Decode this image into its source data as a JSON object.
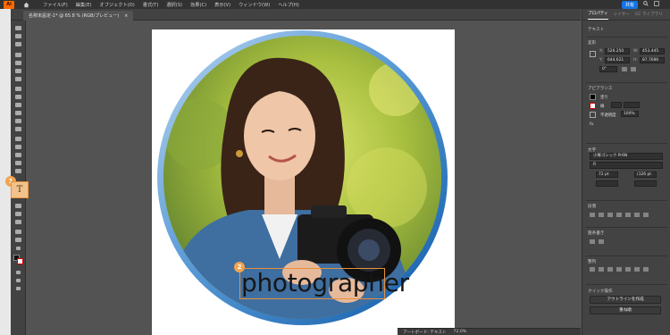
{
  "menubar": {
    "app_logo": "Ai",
    "items": [
      "ファイル(F)",
      "編集(E)",
      "オブジェクト(O)",
      "書式(T)",
      "選択(S)",
      "効果(C)",
      "表示(V)",
      "ウィンドウ(W)",
      "ヘルプ(H)"
    ],
    "share_label": "共有"
  },
  "document": {
    "tab_title": "名称未設定-1* @ 65.8 % (RGB/プレビュー)",
    "close_glyph": "×"
  },
  "callouts": {
    "one": "1",
    "two": "2"
  },
  "tool_highlight": {
    "glyph": "T"
  },
  "canvas": {
    "text": "photographer"
  },
  "panel": {
    "tabs": [
      "プロパティ",
      "レイヤー",
      "CC ライブラリ"
    ],
    "selection_label": "テキスト",
    "transform": {
      "title": "変形",
      "x_label": "X:",
      "x": "526.250",
      "y_label": "Y:",
      "y": "644.621",
      "w_label": "W:",
      "w": "453.445",
      "h_label": "H:",
      "h": "87.7686",
      "rotation": "0°"
    },
    "appearance": {
      "title": "アピアランス",
      "fill_label": "塗り",
      "stroke_label": "線",
      "opacity_label": "不透明度",
      "opacity": "100%",
      "fx": "fx."
    },
    "character": {
      "title": "文字",
      "font_family": "小塚ゴシック Pr6N",
      "font_style": "R",
      "font_size": "72 pt",
      "leading": "(126 pt"
    },
    "paragraph": {
      "title": "段落"
    },
    "area_type": {
      "title": "箇条書き"
    },
    "align": {
      "title": "整列"
    },
    "quick_actions": {
      "title": "クイック操作",
      "outline_button": "アウトラインを作成",
      "arrange_button": "重ね順"
    },
    "colors": {
      "accent": "#1473e6",
      "callout": "#f0a552"
    }
  },
  "statusbar": {
    "artboard": "アートボード: テキスト",
    "zoom_label": "72.0%"
  }
}
